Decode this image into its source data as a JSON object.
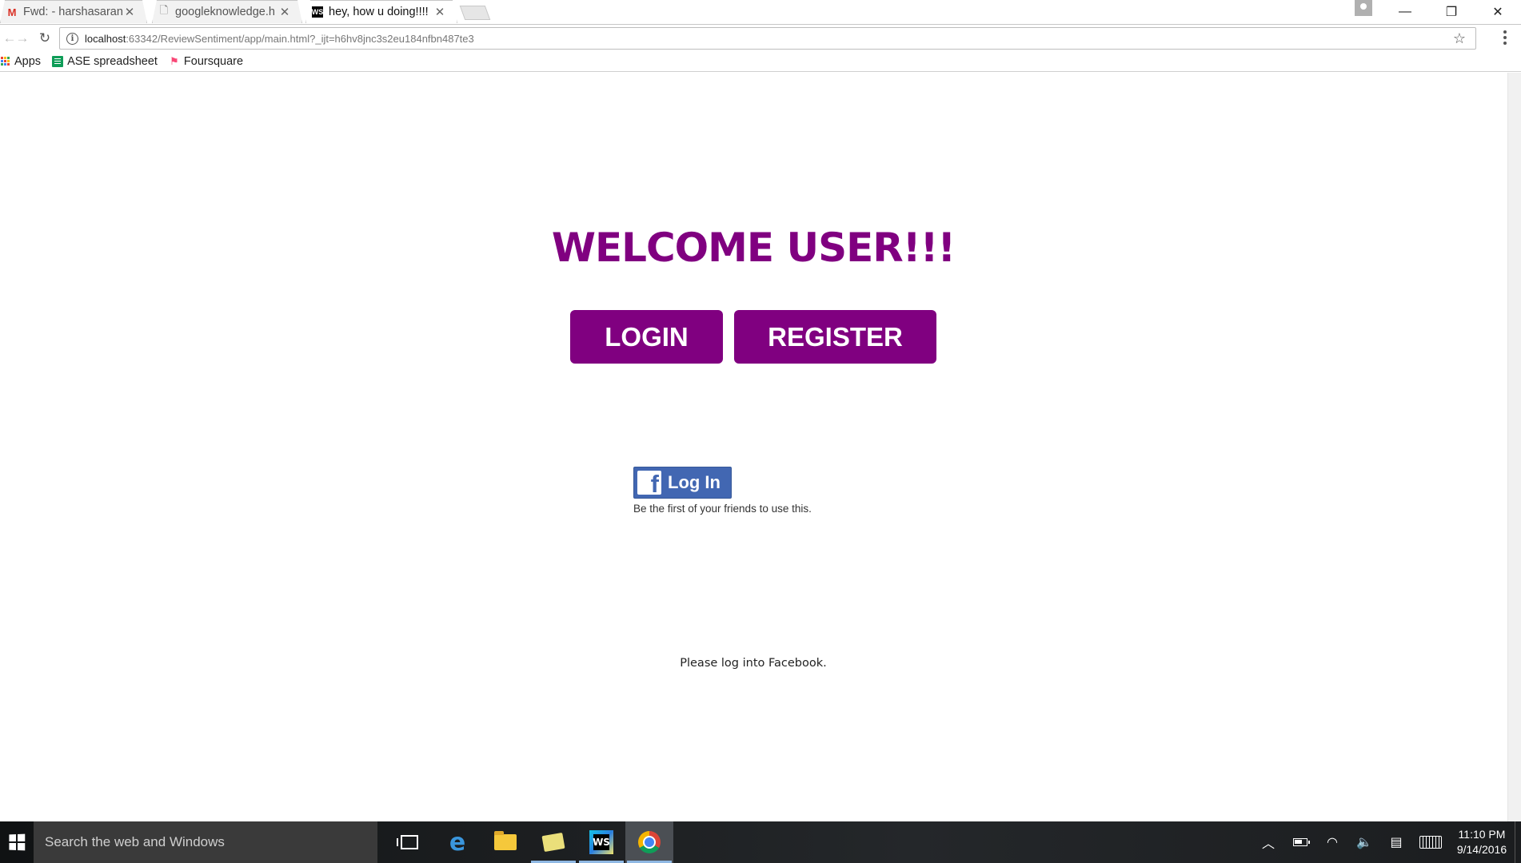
{
  "browser": {
    "tabs": [
      {
        "title": "Fwd: - harshasarana",
        "favicon": "gmail-icon",
        "active": false
      },
      {
        "title": "googleknowledge.h",
        "favicon": "page-icon",
        "active": false
      },
      {
        "title": "hey, how u doing!!!!",
        "favicon": "webstorm-icon",
        "active": true
      }
    ],
    "url": {
      "host": "localhost",
      "rest": ":63342/ReviewSentiment/app/main.html?_ijt=h6hv8jnc3s2eu184nfbn487te3"
    },
    "bookmarks": [
      {
        "label": "Apps",
        "icon": "apps-grid-icon"
      },
      {
        "label": "ASE spreadsheet",
        "icon": "spreadsheet-icon"
      },
      {
        "label": "Foursquare",
        "icon": "foursquare-icon"
      }
    ]
  },
  "page": {
    "heading": "WELCOME USER!!!",
    "login_button": "LOGIN",
    "register_button": "REGISTER",
    "fb_login_label": "Log In",
    "fb_friends_text": "Be the first of your friends to use this.",
    "fb_status": "Please log into Facebook."
  },
  "taskbar": {
    "search_placeholder": "Search the web and Windows",
    "time": "11:10 PM",
    "date": "9/14/2016"
  },
  "colors": {
    "accent_purple": "#800080",
    "facebook_blue": "#4267b2"
  }
}
